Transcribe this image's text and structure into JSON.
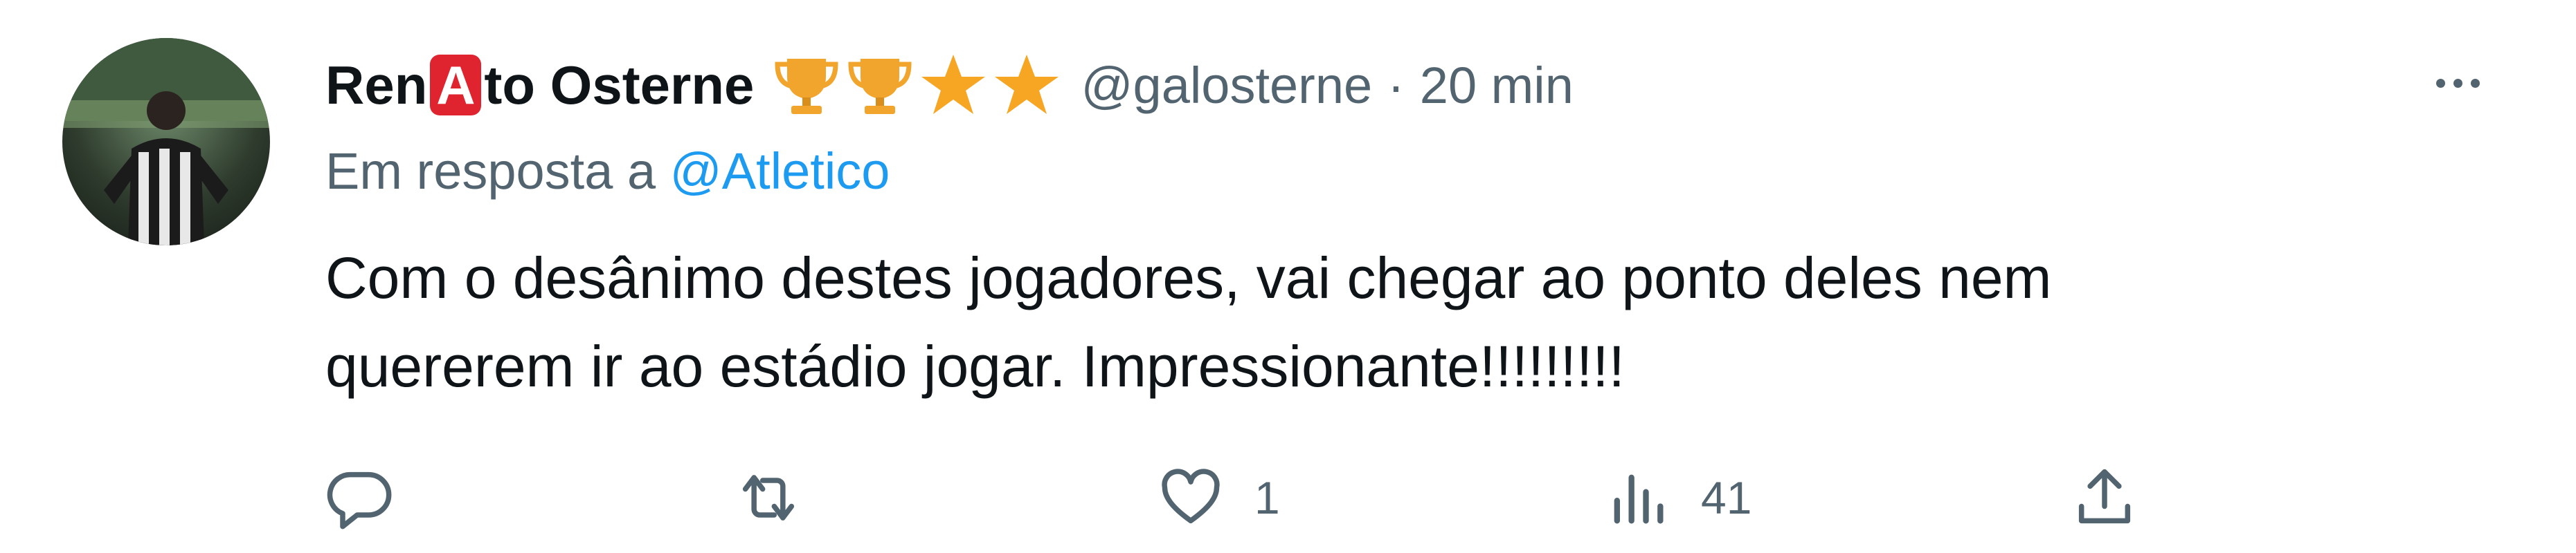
{
  "tweet": {
    "author": {
      "name_prefix": "Ren",
      "name_highlight": "A",
      "name_suffix": "to Osterne",
      "handle": "@galosterne",
      "separator": "·",
      "time": "20 min",
      "badges": [
        "trophy-icon",
        "trophy-icon",
        "star-icon",
        "star-icon"
      ]
    },
    "reply_to": {
      "prefix": "Em resposta a",
      "handle": "@Atletico"
    },
    "text": "Com o desânimo destes jogadores, vai chegar ao ponto deles nem\nquererem ir ao estádio jogar. Impressionante!!!!!!!!!",
    "actions": {
      "reply_icon": "reply-icon",
      "retweet_icon": "retweet-icon",
      "like_icon": "heart-icon",
      "like_count": "1",
      "views_icon": "views-icon",
      "views_count": "41",
      "share_icon": "share-icon"
    },
    "colors": {
      "text": "#0f1419",
      "secondary": "#536471",
      "link": "#1d9bf0",
      "highlight": "#e0242f",
      "gold": "#f2a52c"
    }
  }
}
